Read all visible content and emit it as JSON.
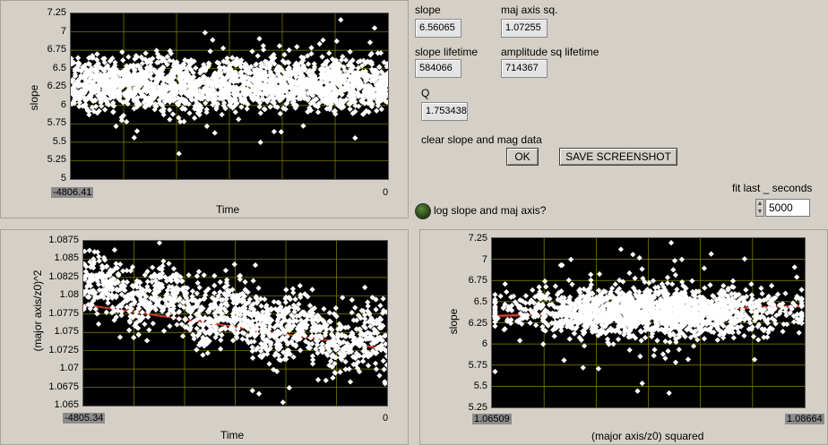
{
  "plot_slope_time": {
    "ylabel": "slope",
    "xlabel": "Time",
    "yticks": [
      "7.25",
      "7",
      "6.75",
      "6.5",
      "6.25",
      "6",
      "5.75",
      "5.5",
      "5.25",
      "5"
    ],
    "xmin": "-4806.41",
    "xmax": "0",
    "colors": {
      "background": "#000000",
      "grid": "#8a8a00",
      "points": "#ffffff"
    }
  },
  "plot_major_time": {
    "ylabel": "(major axis/z0)^2",
    "xlabel": "Time",
    "yticks": [
      "1.0875",
      "1.085",
      "1.0825",
      "1.08",
      "1.0775",
      "1.075",
      "1.0725",
      "1.07",
      "1.0675",
      "1.065"
    ],
    "xmin": "-4805.34",
    "xmax": "0",
    "colors": {
      "background": "#000000",
      "grid": "#8a8a00",
      "points": "#ffffff",
      "fit": "#d33a2a"
    }
  },
  "plot_slope_major": {
    "ylabel": "slope",
    "xlabel": "(major axis/z0) squared",
    "yticks": [
      "7.25",
      "7",
      "6.75",
      "6.5",
      "6.25",
      "6",
      "5.75",
      "5.5",
      "5.25"
    ],
    "xmin": "1.06509",
    "xmax": "1.08664",
    "colors": {
      "background": "#000000",
      "grid": "#8a8a00",
      "points": "#ffffff",
      "fit": "#d33a2a"
    }
  },
  "indicators": {
    "slope": {
      "label": "slope",
      "value": "6.56065"
    },
    "maj_axis_sq": {
      "label": "maj axis sq.",
      "value": "1.07255"
    },
    "slope_lifetime": {
      "label": "slope lifetime",
      "value": "584066"
    },
    "amp_sq_lifetime": {
      "label": "amplitude sq lifetime",
      "value": "714367"
    },
    "q": {
      "label": "Q",
      "value": "1.753438"
    }
  },
  "controls": {
    "clear_label": "clear slope and mag data",
    "ok_button": "OK",
    "save_button": "SAVE SCREENSHOT",
    "log_label": "log slope and maj axis?",
    "fit_label": "fit last _ seconds",
    "fit_value": "5000"
  },
  "chart_data": [
    {
      "type": "scatter",
      "title": "",
      "xlabel": "Time",
      "ylabel": "slope",
      "xlim": [
        -4806.41,
        0
      ],
      "ylim": [
        5,
        7.25
      ],
      "series": [
        {
          "points_summary": "dense band",
          "y_center": 6.3,
          "y_spread": [
            5.8,
            6.8
          ],
          "count_est": 5000
        }
      ]
    },
    {
      "type": "scatter",
      "title": "",
      "xlabel": "Time",
      "ylabel": "(major axis/z0)^2",
      "xlim": [
        -4805.34,
        0
      ],
      "ylim": [
        1.065,
        1.0875
      ],
      "series": [
        {
          "points_summary": "decreasing trend",
          "y_start": 1.082,
          "y_end": 1.0735,
          "count_est": 3000
        }
      ]
    },
    {
      "type": "scatter",
      "title": "",
      "xlabel": "(major axis/z0) squared",
      "ylabel": "slope",
      "xlim": [
        1.06509,
        1.08664
      ],
      "ylim": [
        5.25,
        7.25
      ],
      "series": [
        {
          "points_summary": "cloud",
          "y_center": 6.4,
          "count_est": 3000
        },
        {
          "fit_line": [
            [
              1.06509,
              6.33
            ],
            [
              1.08664,
              6.45
            ]
          ]
        }
      ]
    }
  ]
}
